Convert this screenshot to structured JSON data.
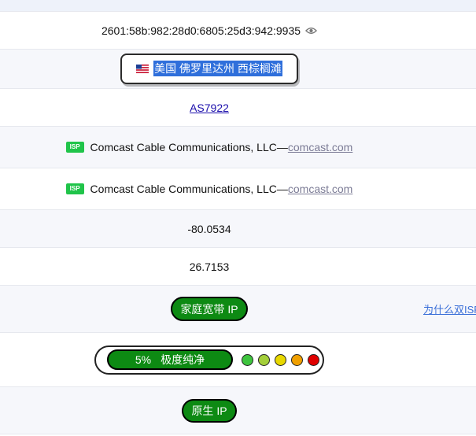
{
  "ip": {
    "address": "2601:58b:982:28d0:6805:25d3:942:9935",
    "icon": "eye-icon"
  },
  "location": {
    "flag_icon": "us-flag-icon",
    "text": "美国 佛罗里达州 西棕榈滩"
  },
  "asn": {
    "label": "AS7922"
  },
  "isp_rows": [
    {
      "tag": "ISP",
      "name": "Comcast Cable Communications, LLC—",
      "domain": "comcast.com"
    },
    {
      "tag": "ISP",
      "name": "Comcast Cable Communications, LLC—",
      "domain": "comcast.com"
    }
  ],
  "longitude": "-80.0534",
  "latitude": "26.7153",
  "type": {
    "label": "家庭宽带 IP",
    "side_link": "为什么双ISP?"
  },
  "purity": {
    "percent_label": "5%",
    "status_label": "极度纯净",
    "dots": [
      "#3ec43e",
      "#a4cf3a",
      "#e8d800",
      "#f0a000",
      "#e00000"
    ]
  },
  "native": {
    "label": "原生 IP"
  },
  "colors": {
    "badge_green": "#0d8a13",
    "isp_tag_green": "#20c44a",
    "highlight": "#2f6fdb"
  }
}
